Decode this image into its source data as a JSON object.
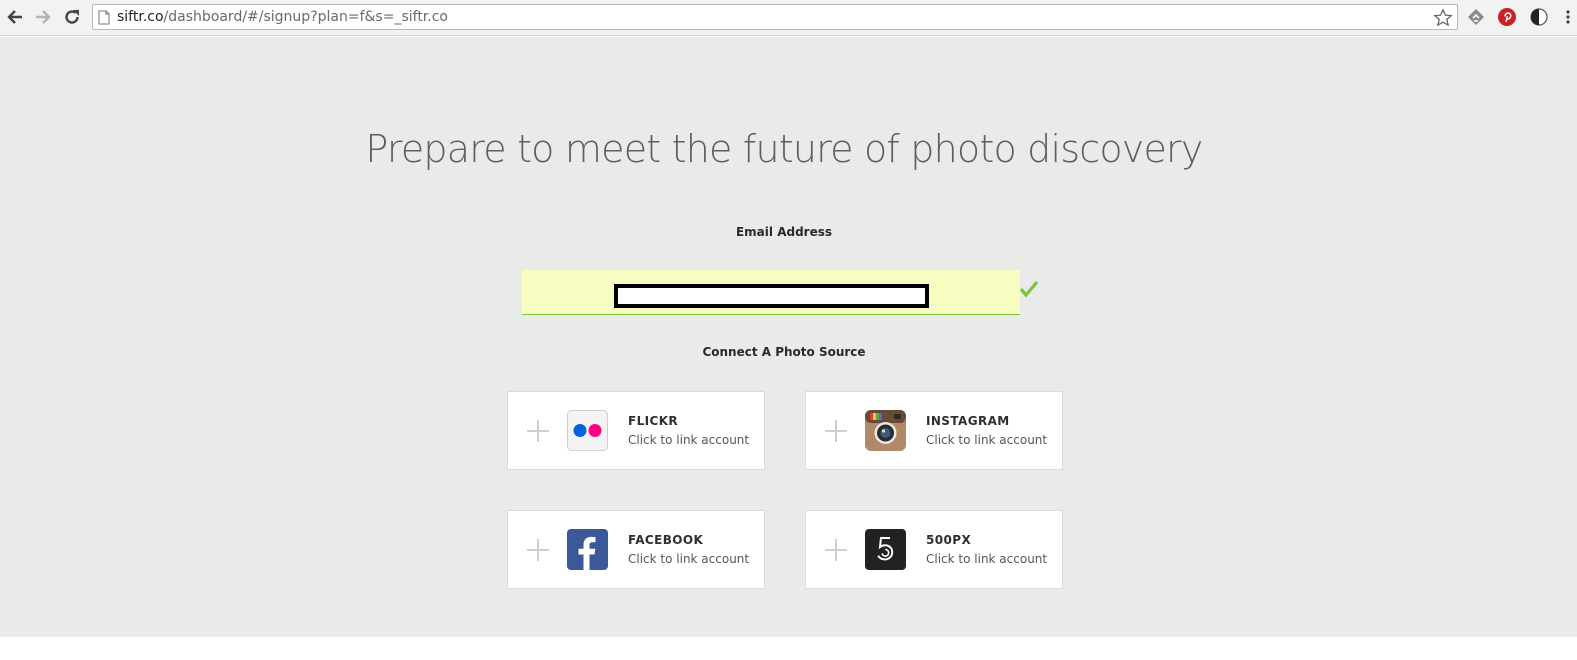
{
  "browser": {
    "url_host": "siftr.co",
    "url_path": "/dashboard/#/signup?plan=f&s=_siftr.co"
  },
  "page": {
    "headline": "Prepare to meet the future of photo discovery",
    "email_label": "Email Address",
    "email_value": "",
    "connect_label": "Connect A Photo Source"
  },
  "sources": [
    {
      "name": "FLICKR",
      "sub": "Click to link account",
      "icon": "flickr-icon"
    },
    {
      "name": "INSTAGRAM",
      "sub": "Click to link account",
      "icon": "instagram-icon"
    },
    {
      "name": "FACEBOOK",
      "sub": "Click to link account",
      "icon": "facebook-icon"
    },
    {
      "name": "500PX",
      "sub": "Click to link account",
      "icon": "500px-icon"
    }
  ],
  "colors": {
    "page_bg": "#e8ebe8",
    "input_bg": "#f7fcc0",
    "check_green": "#7ec23a",
    "flickr_blue": "#0063dc",
    "flickr_pink": "#ff0084",
    "facebook_blue": "#3b5998",
    "pinterest_red": "#cb2027"
  }
}
